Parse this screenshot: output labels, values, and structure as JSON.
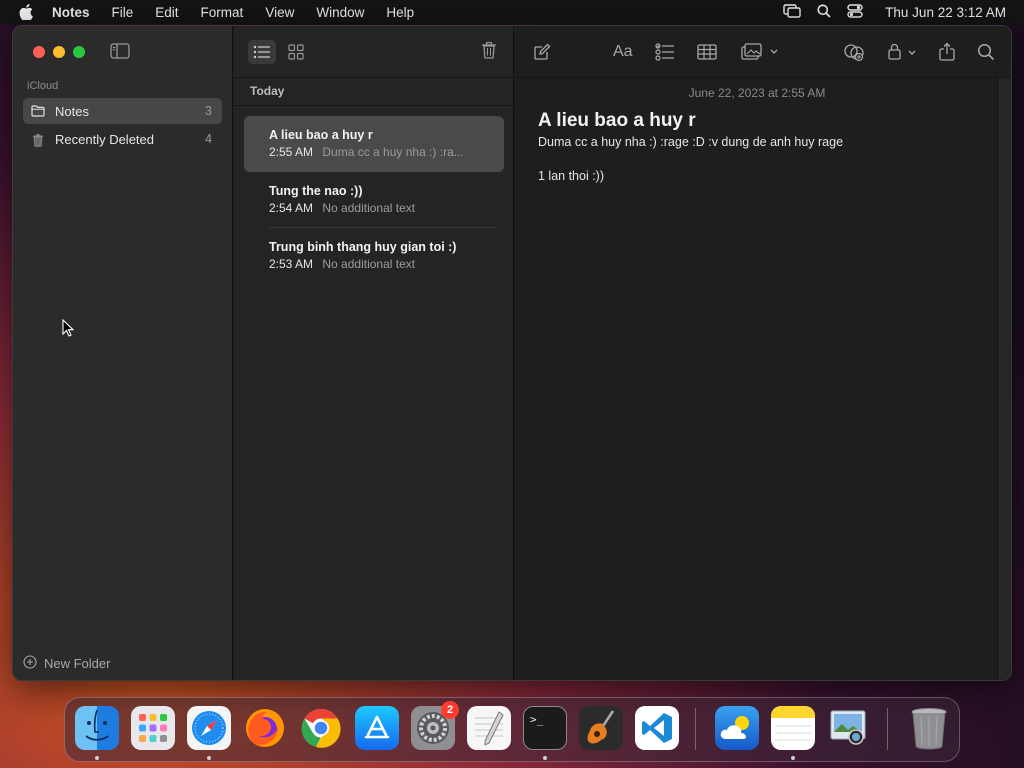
{
  "menubar": {
    "app_name": "Notes",
    "menus": [
      "File",
      "Edit",
      "Format",
      "View",
      "Window",
      "Help"
    ],
    "clock": "Thu Jun 22  3:12 AM"
  },
  "sidebar": {
    "account_label": "iCloud",
    "folders": [
      {
        "label": "Notes",
        "count": "3",
        "icon": "folder-icon"
      },
      {
        "label": "Recently Deleted",
        "count": "4",
        "icon": "trash-icon"
      }
    ],
    "new_folder_label": "New Folder"
  },
  "notes_list": {
    "section": "Today",
    "notes": [
      {
        "title": "A lieu bao a huy r",
        "time": "2:55 AM",
        "preview": "Duma cc a huy nha :) :ra..."
      },
      {
        "title": "Tung the nao :))",
        "time": "2:54 AM",
        "preview": "No additional text"
      },
      {
        "title": "Trung binh thang huy gian toi :)",
        "time": "2:53 AM",
        "preview": "No additional text"
      }
    ]
  },
  "editor": {
    "date": "June 22, 2023 at 2:55 AM",
    "title": "A lieu bao a huy r",
    "lines": [
      "Duma cc a huy nha :) :rage :D :v dung de anh huy rage",
      "",
      "1 lan thoi :))"
    ],
    "format_label": "Aa"
  },
  "dock": {
    "apps": [
      "Finder",
      "Launchpad",
      "Safari",
      "Firefox",
      "Chrome",
      "App Store",
      "System Settings",
      "TextEdit",
      "Terminal",
      "GarageBand",
      "Visual Studio Code",
      "Weather",
      "Notes",
      "Preview",
      "Trash"
    ],
    "settings_badge": "2",
    "terminal_glyph": ">_"
  }
}
